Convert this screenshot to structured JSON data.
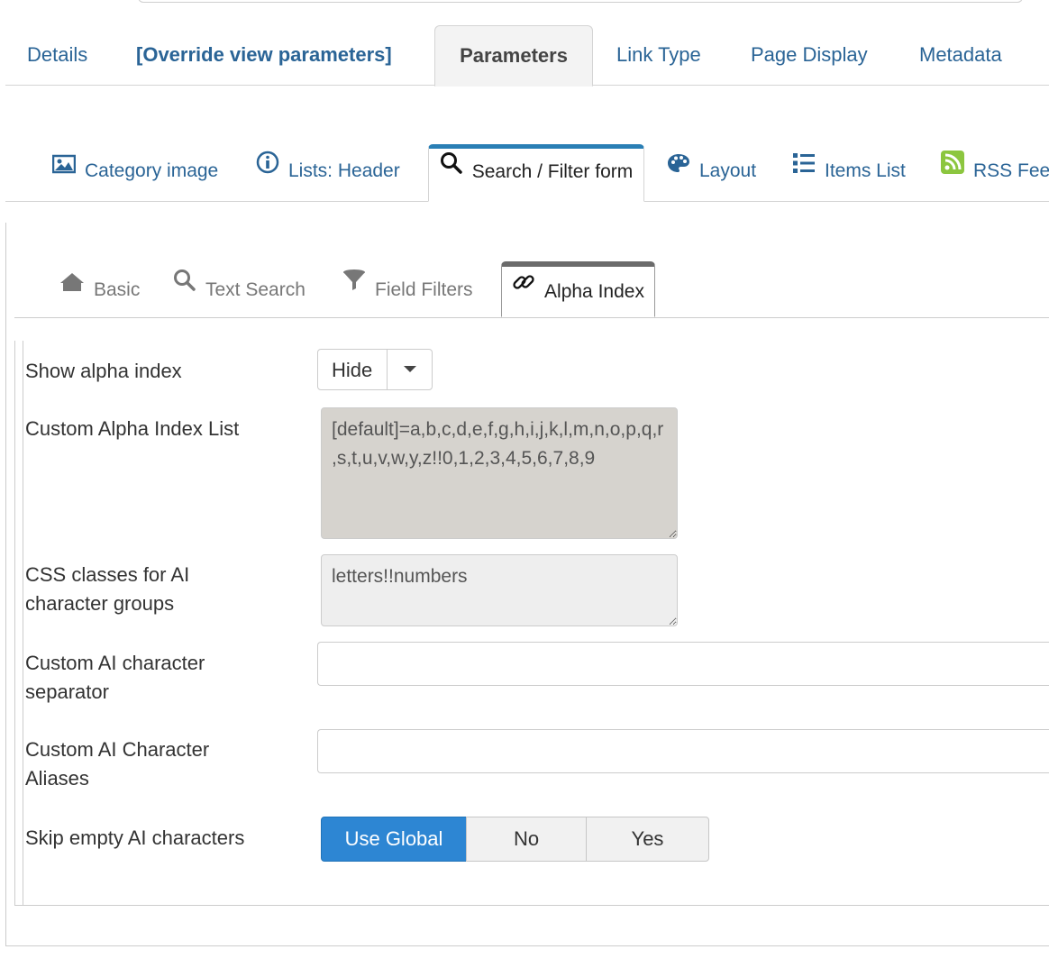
{
  "tabs_level1": [
    {
      "label": "Details",
      "active": false
    },
    {
      "label": "[Override view parameters]",
      "active": false
    },
    {
      "label": "Parameters",
      "active": true
    },
    {
      "label": "Link Type",
      "active": false
    },
    {
      "label": "Page Display",
      "active": false
    },
    {
      "label": "Metadata",
      "active": false
    }
  ],
  "tabs_level2": [
    {
      "label": "Category image",
      "icon": "image-icon",
      "active": false
    },
    {
      "label": "Lists: Header",
      "icon": "info-icon",
      "active": false
    },
    {
      "label": "Search / Filter form",
      "icon": "search-icon",
      "active": true
    },
    {
      "label": "Layout",
      "icon": "palette-icon",
      "active": false
    },
    {
      "label": "Items List",
      "icon": "list-icon",
      "active": false
    },
    {
      "label": "RSS Fee",
      "icon": "rss-icon",
      "active": false
    }
  ],
  "tabs_level3": [
    {
      "label": "Basic",
      "icon": "home-icon",
      "active": false
    },
    {
      "label": "Text Search",
      "icon": "search-icon",
      "active": false
    },
    {
      "label": "Field Filters",
      "icon": "filter-icon",
      "active": false
    },
    {
      "label": "Alpha Index",
      "icon": "link-icon",
      "active": true
    }
  ],
  "form": {
    "show_alpha_index": {
      "label": "Show alpha index",
      "value": "Hide"
    },
    "custom_alpha_index_list": {
      "label": "Custom Alpha Index List",
      "value": "[default]=a,b,c,d,e,f,g,h,i,j,k,l,m,n,o,p,q,r,s,t,u,v,w,y,z!!0,1,2,3,4,5,6,7,8,9"
    },
    "css_classes": {
      "label": "CSS classes for AI character groups",
      "value": "letters!!numbers"
    },
    "custom_separator": {
      "label": "Custom AI character separator",
      "value": ""
    },
    "custom_aliases": {
      "label": "Custom AI Character Aliases",
      "value": ""
    },
    "skip_empty": {
      "label": "Skip empty AI characters",
      "options": [
        "Use Global",
        "No",
        "Yes"
      ],
      "selected": "Use Global"
    }
  },
  "colors": {
    "link": "#2a6496",
    "active_tab_top": "#2a7fb5",
    "btn_primary": "#2d86d3",
    "rss": "#8cc63f"
  }
}
